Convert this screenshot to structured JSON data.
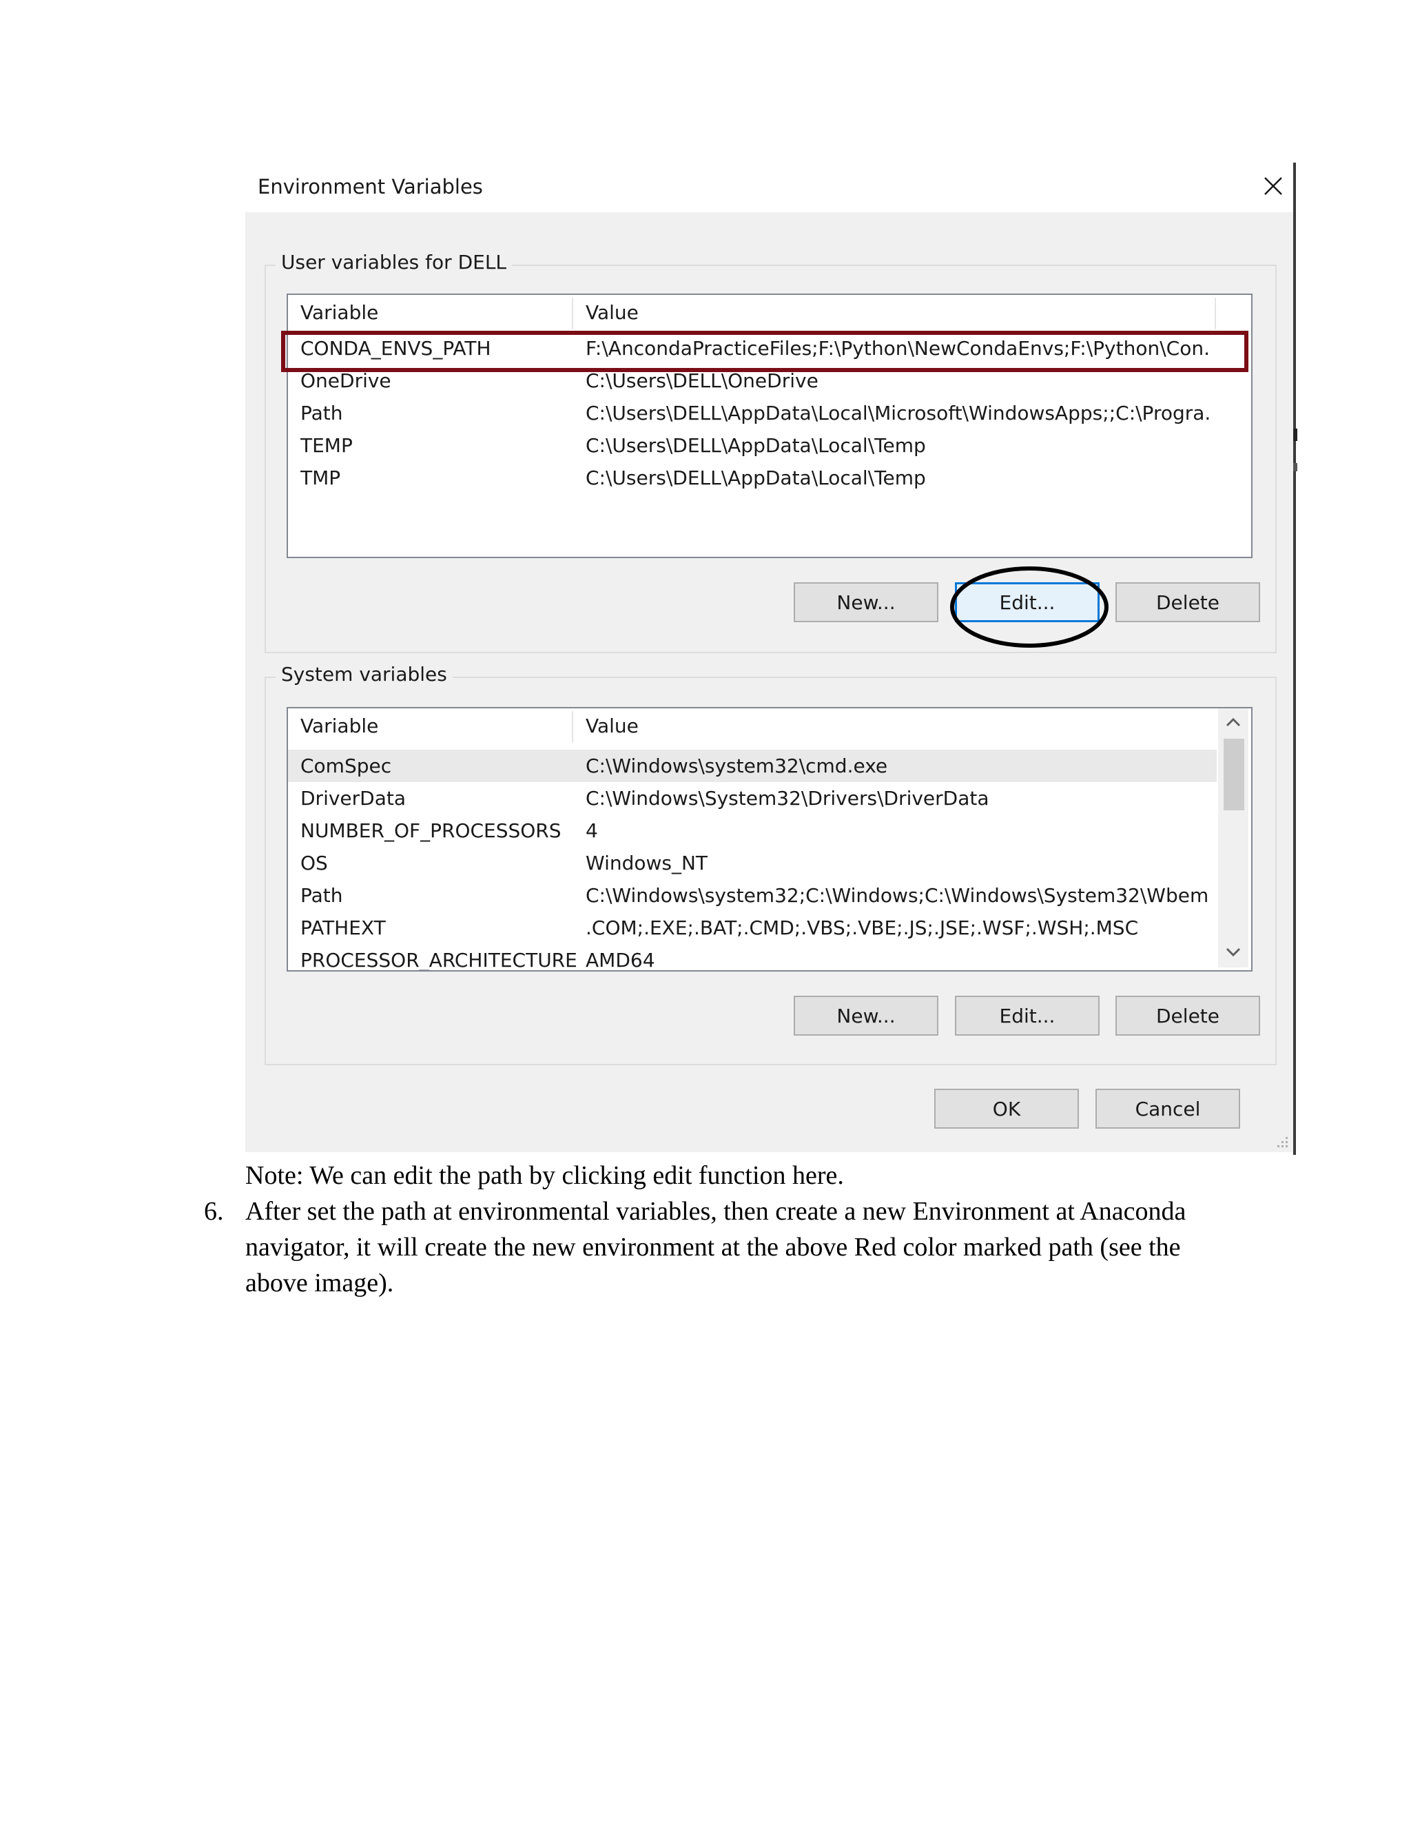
{
  "dialog": {
    "title": "Environment Variables",
    "user_group": {
      "label": "User variables for DELL",
      "columns": [
        "Variable",
        "Value"
      ],
      "rows": [
        {
          "variable": "CONDA_ENVS_PATH",
          "value": "F:\\AncondaPracticeFiles;F:\\Python\\NewCondaEnvs;F:\\Python\\Con..."
        },
        {
          "variable": "OneDrive",
          "value": "C:\\Users\\DELL\\OneDrive"
        },
        {
          "variable": "Path",
          "value": "C:\\Users\\DELL\\AppData\\Local\\Microsoft\\WindowsApps;;C:\\Progra..."
        },
        {
          "variable": "TEMP",
          "value": "C:\\Users\\DELL\\AppData\\Local\\Temp"
        },
        {
          "variable": "TMP",
          "value": "C:\\Users\\DELL\\AppData\\Local\\Temp"
        }
      ],
      "buttons": {
        "new": "New...",
        "edit": "Edit...",
        "delete": "Delete"
      }
    },
    "system_group": {
      "label": "System variables",
      "columns": [
        "Variable",
        "Value"
      ],
      "rows": [
        {
          "variable": "ComSpec",
          "value": "C:\\Windows\\system32\\cmd.exe"
        },
        {
          "variable": "DriverData",
          "value": "C:\\Windows\\System32\\Drivers\\DriverData"
        },
        {
          "variable": "NUMBER_OF_PROCESSORS",
          "value": "4"
        },
        {
          "variable": "OS",
          "value": "Windows_NT"
        },
        {
          "variable": "Path",
          "value": "C:\\Windows\\system32;C:\\Windows;C:\\Windows\\System32\\Wbem;..."
        },
        {
          "variable": "PATHEXT",
          "value": ".COM;.EXE;.BAT;.CMD;.VBS;.VBE;.JS;.JSE;.WSF;.WSH;.MSC"
        },
        {
          "variable": "PROCESSOR_ARCHITECTURE",
          "value": "AMD64"
        }
      ],
      "buttons": {
        "new": "New...",
        "edit": "Edit...",
        "delete": "Delete"
      }
    },
    "ok_label": "OK",
    "cancel_label": "Cancel",
    "icons": {
      "close": "close-icon",
      "scroll_up": "chevron-up-icon",
      "scroll_down": "chevron-down-icon",
      "grip": "resize-grip-icon"
    },
    "colors": {
      "annotation_rect": "#7a0d16",
      "annotation_ellipse": "#000000",
      "focus": "#0078d7"
    }
  },
  "document": {
    "note": "Note: We can edit the path by clicking edit function here.",
    "step_number": "6.",
    "step_lines": [
      "After set the path at environmental variables, then create a new Environment at Anaconda",
      "navigator, it will create the new environment at the above Red color marked path (see the",
      "above image)."
    ]
  }
}
